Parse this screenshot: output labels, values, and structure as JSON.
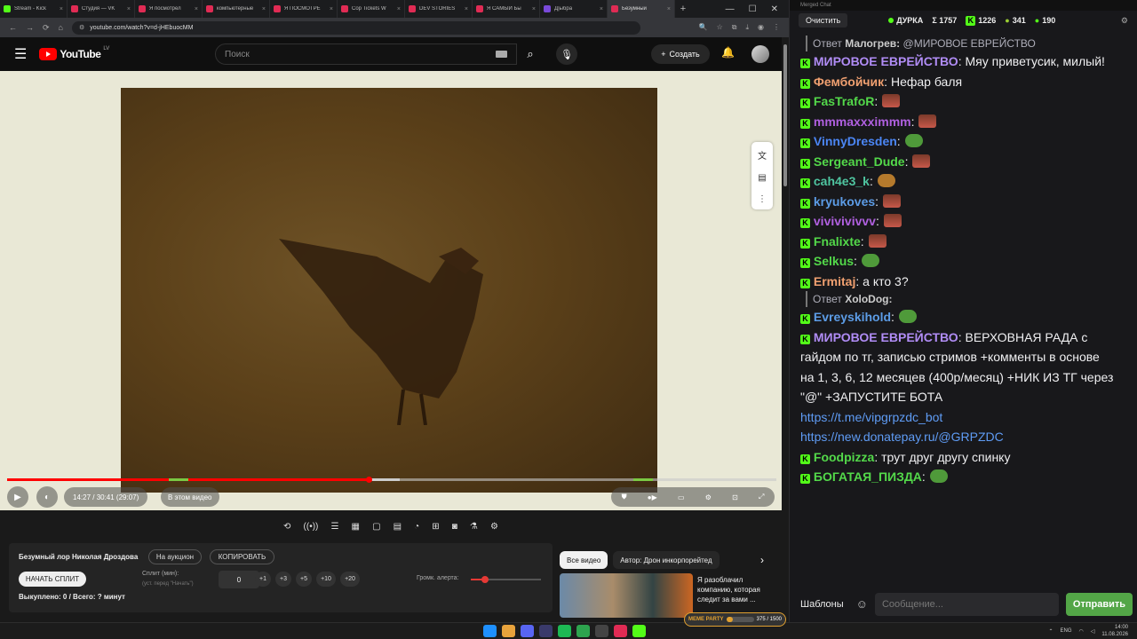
{
  "browser": {
    "tabs": [
      {
        "label": "Stream - Kick",
        "color": "#53fc18"
      },
      {
        "label": "Студия — VK",
        "color": "#e02b54"
      },
      {
        "label": "Я посмотрел",
        "color": "#e02b54"
      },
      {
        "label": "компьютерные",
        "color": "#e02b54"
      },
      {
        "label": "Я ПОСМОТРЕ",
        "color": "#e02b54"
      },
      {
        "label": "Cop Tickets W",
        "color": "#e02b54"
      },
      {
        "label": "DEV STORIES",
        "color": "#e02b54"
      },
      {
        "label": "Я САМЫЙ Бы",
        "color": "#e02b54"
      },
      {
        "label": "Д|ыбра",
        "color": "#7a4ad9"
      },
      {
        "label": "Безумный",
        "color": "#e02b54",
        "active": true
      }
    ],
    "url": "youtube.com/watch?v=d-jHEbuocMM"
  },
  "youtube": {
    "logo": "YouTube",
    "country": "LV",
    "search_placeholder": "Поиск",
    "create_label": "Создать",
    "player": {
      "time": "14:27 / 30:41 (29:07)",
      "chapter": "В этом видео",
      "progress_fraction": 0.47,
      "buffer_fraction": 0.51
    },
    "extension": {
      "title": "Безумный лор Николая Дроздова",
      "auction_btn": "На аукцион",
      "copy_btn": "КОПИРОВАТЬ",
      "start_split": "НАЧАТЬ СПЛИТ",
      "split_label": "Сплит (мин):",
      "split_hint": "(уст. перед \"Начать\")",
      "split_value": "0",
      "plus_buttons": [
        "+1",
        "+3",
        "+5",
        "+10",
        "+20"
      ],
      "volume_label": "Громк. алерта:",
      "volume_fraction": 0.2,
      "bought": "Выкуплено: 0 / Всего: ? минут"
    },
    "chips": [
      "Все видео",
      "Автор: Дрон инкорпорейтед"
    ],
    "rec": {
      "title": "Я разоблачил компанию, которая следит за вами ..."
    }
  },
  "chat": {
    "window_title": "Merged Chat",
    "clear": "Очистить",
    "channel": "ДУРКА",
    "sum": "Σ 1757",
    "kick_count": "1226",
    "stat2": "341",
    "stat3": "190",
    "messages": [
      {
        "type": "reply",
        "reply_prefix": "Ответ",
        "reply_user": "Малогрев:",
        "reply_text": "@МИРОВОЕ ЕВРЕЙСТВО"
      },
      {
        "user": "МИРОВОЕ ЕВРЕЙСТВО",
        "color": "#b08cf5",
        "text": "Мяу приветусик, милый!",
        "emo": ""
      },
      {
        "user": "Фембойчик",
        "color": "#f0a070",
        "text": "Нефар баля",
        "emo": ""
      },
      {
        "user": "FasTrafoR",
        "color": "#53d94a",
        "text": "",
        "emo": "face"
      },
      {
        "user": "mmmaxxximmm",
        "color": "#b060e0",
        "text": "",
        "emo": "face"
      },
      {
        "user": "VinnyDresden",
        "color": "#4b86f5",
        "text": "",
        "emo": "frog"
      },
      {
        "user": "Sergeant_Dude",
        "color": "#53d94a",
        "text": "",
        "emo": "face"
      },
      {
        "user": "cah4e3_k",
        "color": "#4fc5a0",
        "text": "",
        "emo": "dog"
      },
      {
        "user": "kryukoves",
        "color": "#5c9ce6",
        "text": "",
        "emo": "face"
      },
      {
        "user": "vivivivivvv",
        "color": "#b060e0",
        "text": "",
        "emo": "face"
      },
      {
        "user": "Fnalixte",
        "color": "#53d94a",
        "text": "",
        "emo": "face"
      },
      {
        "user": "Selkus",
        "color": "#53d94a",
        "text": "",
        "emo": "frog"
      },
      {
        "user": "Ermitaj",
        "color": "#f0a070",
        "text": "а кто 3?",
        "emo": ""
      },
      {
        "type": "reply",
        "reply_prefix": "Ответ",
        "reply_user": "XoloDog:",
        "reply_text": ""
      },
      {
        "user": "Evreyskihold",
        "color": "#5c9ce6",
        "text": "",
        "emo": "frog"
      },
      {
        "user": "МИРОВОЕ ЕВРЕЙСТВО",
        "color": "#b08cf5",
        "text": "ВЕРХОВНАЯ РАДА с гайдом по тг, записью стримов +комменты в основе",
        "emo": ""
      },
      {
        "text_only": "на 1, 3, 6, 12 месяцев (400р/месяц) +НИК ИЗ ТГ через \"@\" +ЗАПУСТИТЕ БОТА"
      },
      {
        "link": "https://t.me/vipgrpzdc_bot"
      },
      {
        "link": "https://new.donatepay.ru/@GRPZDC"
      },
      {
        "user": "Foodpizza",
        "color": "#53d94a",
        "text": "трут друг другу спинку",
        "emo": ""
      },
      {
        "user": "БОГАТАЯ_ПИЗДА",
        "color": "#53d94a",
        "text": "",
        "emo": "frog"
      }
    ],
    "templates": "Шаблоны",
    "placeholder": "Сообщение...",
    "send": "Отправить"
  },
  "taskbar": {
    "lang": "ENG",
    "time": "14:00",
    "date": "11.08.2026",
    "overlay_label": "MEME PARTY",
    "overlay_value": "375 / 1500",
    "overlay_fraction": 0.25
  },
  "colors": {
    "accent_kick": "#53fc18",
    "yt_red": "#ff0000",
    "send_green": "#53a647"
  }
}
